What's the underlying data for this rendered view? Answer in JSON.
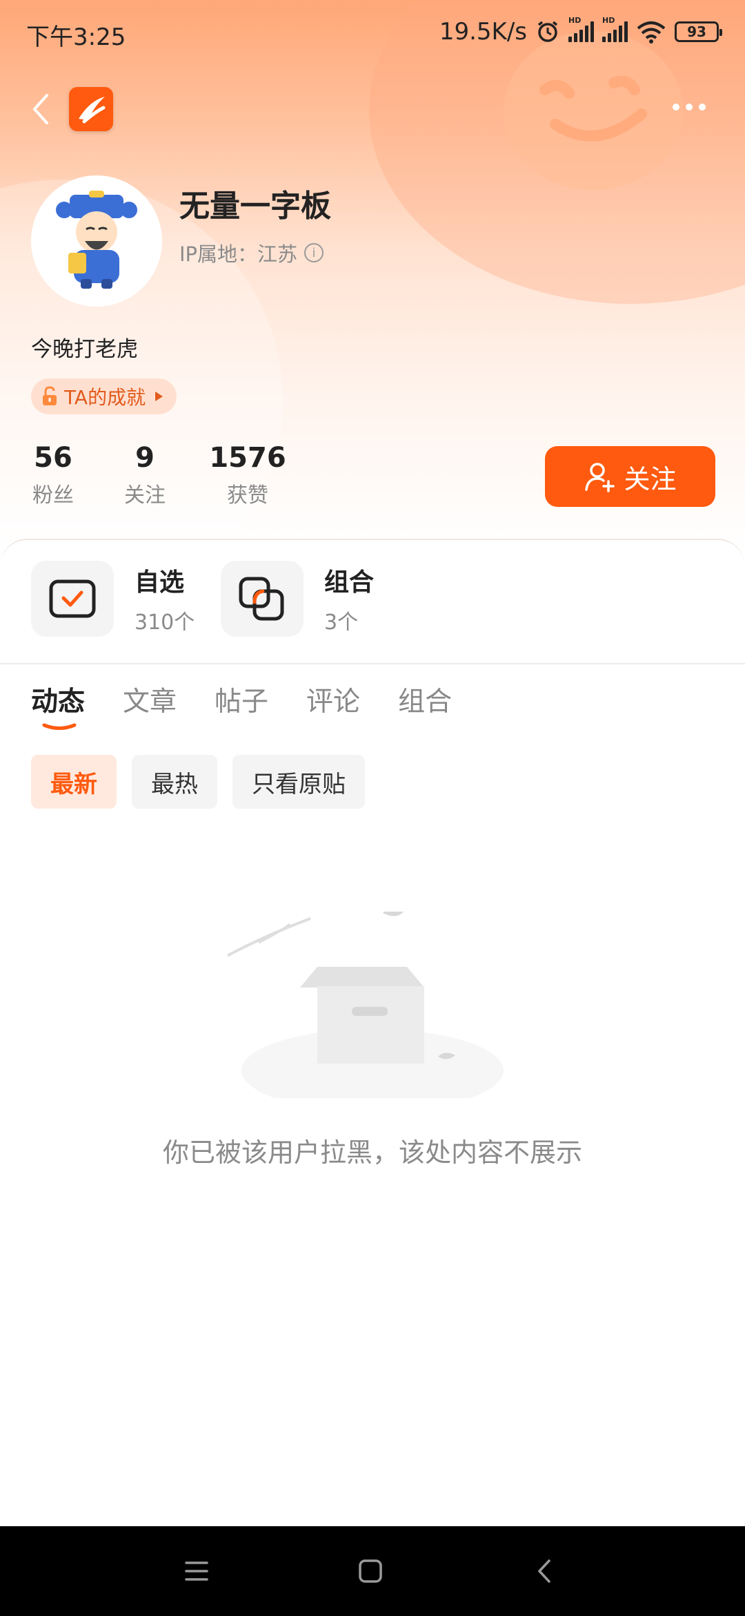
{
  "status_bar": {
    "time": "下午3:25",
    "net_speed": "19.5K/s",
    "hd1": "HD",
    "hd2": "HD",
    "battery": "93"
  },
  "header": {
    "back_icon": "back-chevron-icon",
    "app_logo": "app-logo-icon",
    "more_icon": "more-dots-icon"
  },
  "profile": {
    "name": "无量一字板",
    "ip_location": "IP属地：江苏",
    "bio": "今晚打老虎",
    "achievement": "TA的成就"
  },
  "stats": [
    {
      "num": "56",
      "label": "粉丝"
    },
    {
      "num": "9",
      "label": "关注"
    },
    {
      "num": "1576",
      "label": "获赞"
    }
  ],
  "follow_button": "关注",
  "quick_cards": [
    {
      "title": "自选",
      "sub": "310个",
      "icon": "watchlist-icon"
    },
    {
      "title": "组合",
      "sub": "3个",
      "icon": "portfolio-icon"
    }
  ],
  "tabs": [
    "动态",
    "文章",
    "帖子",
    "评论",
    "组合"
  ],
  "filters": [
    "最新",
    "最热",
    "只看原贴"
  ],
  "empty_message": "你已被该用户拉黑，该处内容不展示",
  "colors": {
    "accent": "#ff5a0f",
    "chip_active_bg": "#ffe9df"
  }
}
